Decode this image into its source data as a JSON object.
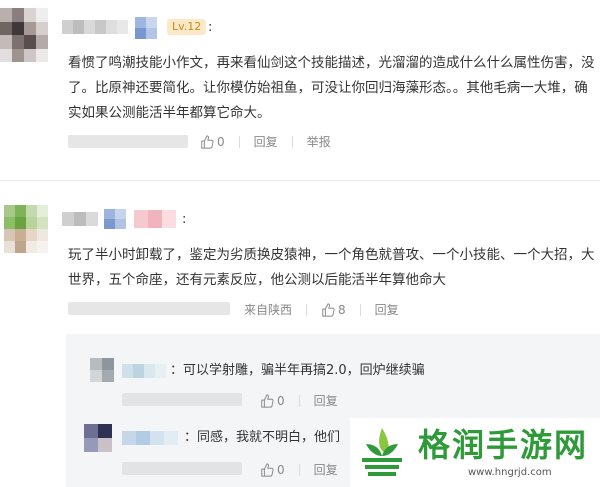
{
  "comment1": {
    "level_badge": "Lv.12",
    "colon": ":",
    "lines": [
      "看惯了鸣潮技能小作文，再来看仙剑这个技能描述，光溜溜的造成什么什么属性伤害，没",
      "了。比原神还要简化。让你模仿始祖鱼，可没让你回归海藻形态。。其他毛病一大堆，确",
      "实如果公测能活半年都算它命大。"
    ],
    "likes": "0",
    "reply_label": "回复",
    "report_label": "举报"
  },
  "comment2": {
    "colon": ":",
    "lines": [
      "玩了半小时卸载了，鉴定为劣质换皮猿神，一个角色就普攻、一个小技能、一个大招，大",
      "世界，五个命座，还有元素反应，他公测以后能活半年算他命大"
    ],
    "location": "来自陕西",
    "likes": "8",
    "reply_label": "回复"
  },
  "replies": [
    {
      "text": "：可以学射雕，骗半年再搞2.0，回炉继续骗",
      "likes": "0",
      "reply_label": "回复"
    },
    {
      "text": "：同感，我就不明白，他们",
      "likes": "0",
      "reply_label": "回复"
    }
  ],
  "watermark": {
    "brand": "格润手游网",
    "url": "www.hngrjd.com"
  },
  "colors": {
    "watermark_green": "#2f9a3a",
    "text": "#333333",
    "meta": "#888888",
    "reply_bg": "#f4f5f7"
  }
}
